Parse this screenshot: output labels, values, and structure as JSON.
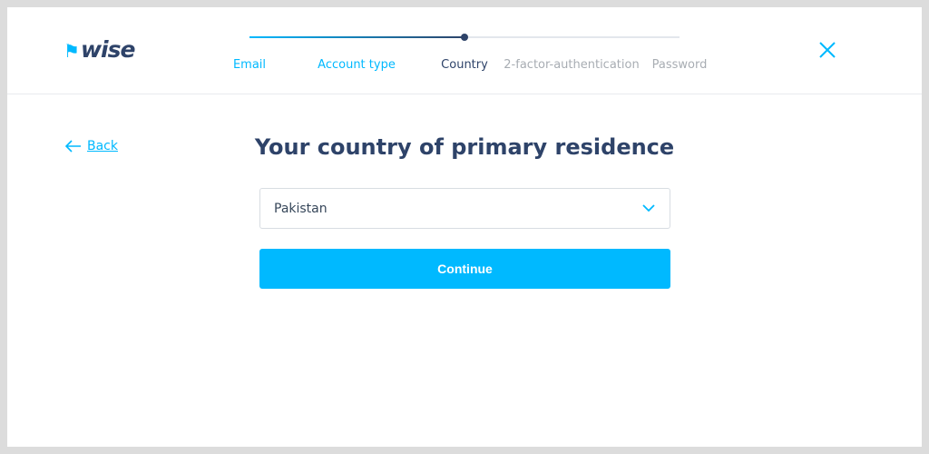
{
  "brand": {
    "name": "wise",
    "accent": "#00b9ff",
    "navy": "#2e4369"
  },
  "steps": [
    {
      "label": "Email",
      "state": "done"
    },
    {
      "label": "Account type",
      "state": "done"
    },
    {
      "label": "Country",
      "state": "current"
    },
    {
      "label": "2-factor-authentication",
      "state": "todo"
    },
    {
      "label": "Password",
      "state": "todo"
    }
  ],
  "back_label": "Back",
  "title": "Your country of primary residence",
  "country_select": {
    "value": "Pakistan"
  },
  "continue_label": "Continue"
}
